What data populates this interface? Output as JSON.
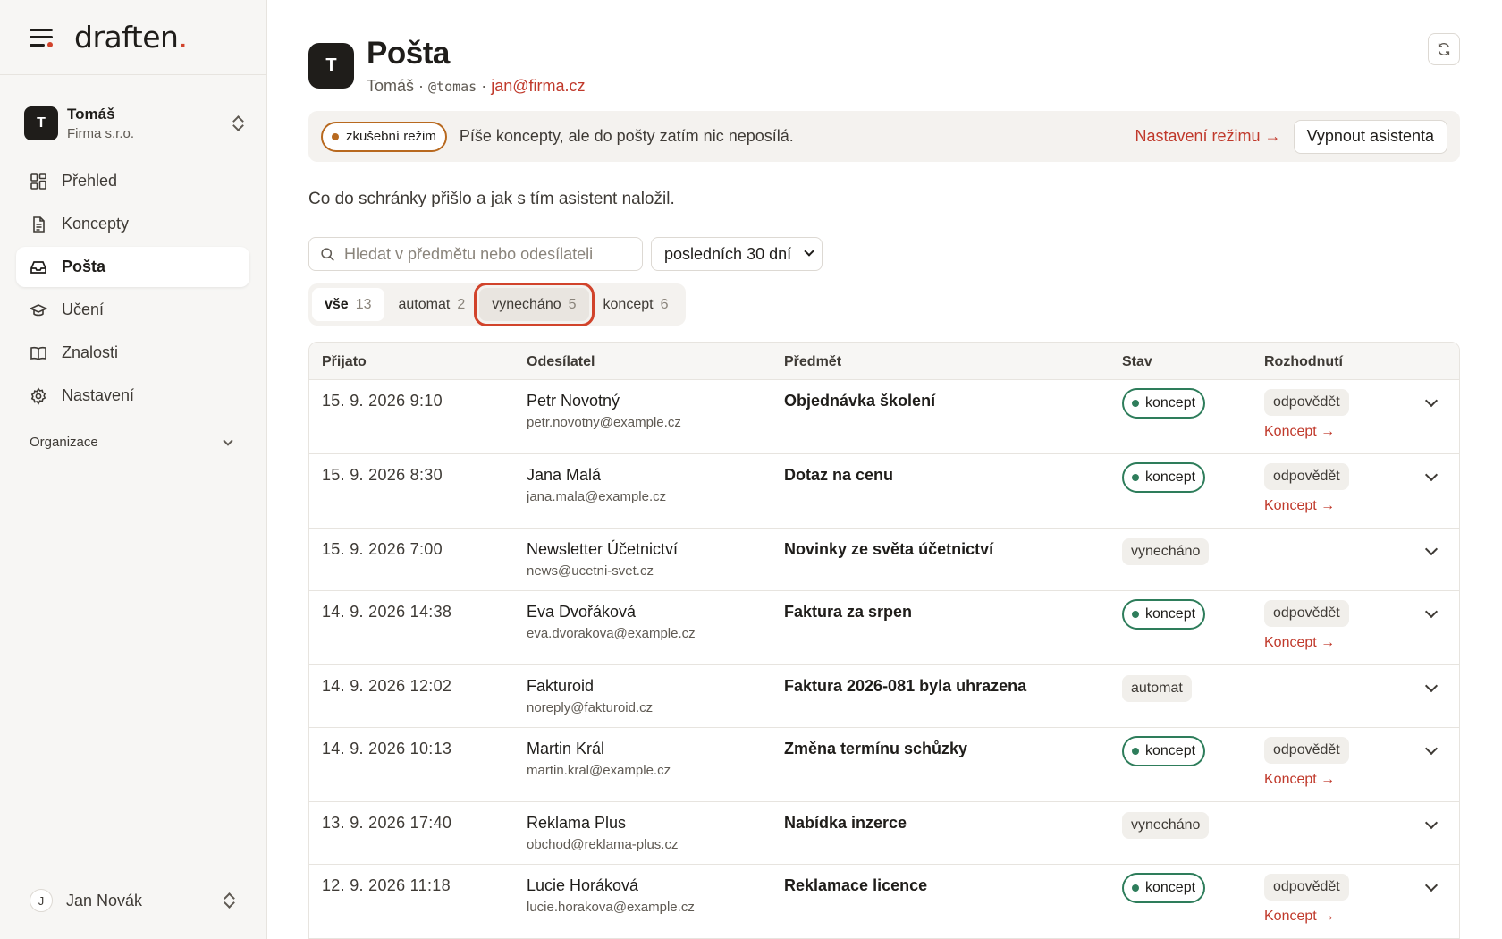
{
  "brand": {
    "name": "draften",
    "dot": "."
  },
  "account": {
    "initial": "T",
    "name": "Tomáš",
    "company": "Firma s.r.o."
  },
  "nav": [
    {
      "label": "Přehled",
      "icon": "grid-icon"
    },
    {
      "label": "Koncepty",
      "icon": "document-icon"
    },
    {
      "label": "Pošta",
      "icon": "inbox-icon",
      "active": true
    },
    {
      "label": "Učení",
      "icon": "graduation-cap-icon"
    },
    {
      "label": "Znalosti",
      "icon": "book-icon"
    },
    {
      "label": "Nastavení",
      "icon": "gear-icon"
    }
  ],
  "organization": {
    "label": "Organizace"
  },
  "user": {
    "initial": "J",
    "name": "Jan Novák"
  },
  "header": {
    "initial": "T",
    "title": "Pošta",
    "name": "Tomáš",
    "sep1": " · ",
    "handle": "@tomas",
    "sep2": " · ",
    "email": "jan@firma.cz"
  },
  "banner": {
    "mode_label": "zkušební režim",
    "text": "Píše koncepty, ale do pošty zatím nic neposílá.",
    "settings_link": "Nastavení režimu →",
    "off_button": "Vypnout asistenta"
  },
  "lead": "Co do schránky přišlo a jak s tím asistent naložil.",
  "search": {
    "placeholder": "Hledat v předmětu nebo odesílateli"
  },
  "period": {
    "selected": "posledních 30 dní"
  },
  "tabs": [
    {
      "label": "vše",
      "count": "13"
    },
    {
      "label": "automat",
      "count": "2"
    },
    {
      "label": "vynecháno",
      "count": "5"
    },
    {
      "label": "koncept",
      "count": "6"
    }
  ],
  "table": {
    "columns": [
      "Přijato",
      "Odesílatel",
      "Předmět",
      "Stav",
      "Rozhodnutí"
    ],
    "rows": [
      {
        "date": "15. 9. 2026 9:10",
        "sender": "Petr Novotný",
        "email": "petr.novotny@example.cz",
        "subject": "Objednávka školení",
        "state": "koncept",
        "decision": "odpovědět",
        "link": "Koncept →"
      },
      {
        "date": "15. 9. 2026 8:30",
        "sender": "Jana Malá",
        "email": "jana.mala@example.cz",
        "subject": "Dotaz na cenu",
        "state": "koncept",
        "decision": "odpovědět",
        "link": "Koncept →"
      },
      {
        "date": "15. 9. 2026 7:00",
        "sender": "Newsletter Účetnictví",
        "email": "news@ucetni-svet.cz",
        "subject": "Novinky ze světa účetnictví",
        "state": "vynecháno"
      },
      {
        "date": "14. 9. 2026 14:38",
        "sender": "Eva Dvořáková",
        "email": "eva.dvorakova@example.cz",
        "subject": "Faktura za srpen",
        "state": "koncept",
        "decision": "odpovědět",
        "link": "Koncept →"
      },
      {
        "date": "14. 9. 2026 12:02",
        "sender": "Fakturoid",
        "email": "noreply@fakturoid.cz",
        "subject": "Faktura 2026-081 byla uhrazena",
        "state": "automat"
      },
      {
        "date": "14. 9. 2026 10:13",
        "sender": "Martin Král",
        "email": "martin.kral@example.cz",
        "subject": "Změna termínu schůzky",
        "state": "koncept",
        "decision": "odpovědět",
        "link": "Koncept →"
      },
      {
        "date": "13. 9. 2026 17:40",
        "sender": "Reklama Plus",
        "email": "obchod@reklama-plus.cz",
        "subject": "Nabídka inzerce",
        "state": "vynecháno"
      },
      {
        "date": "12. 9. 2026 11:18",
        "sender": "Lucie Horáková",
        "email": "lucie.horakova@example.cz",
        "subject": "Reklamace licence",
        "state": "koncept",
        "decision": "odpovědět",
        "link": "Koncept →"
      }
    ]
  },
  "colors": {
    "accent": "#d1432b",
    "link": "#c0392b",
    "koncept": "#2e7d5b",
    "trial": "#b8691f"
  }
}
